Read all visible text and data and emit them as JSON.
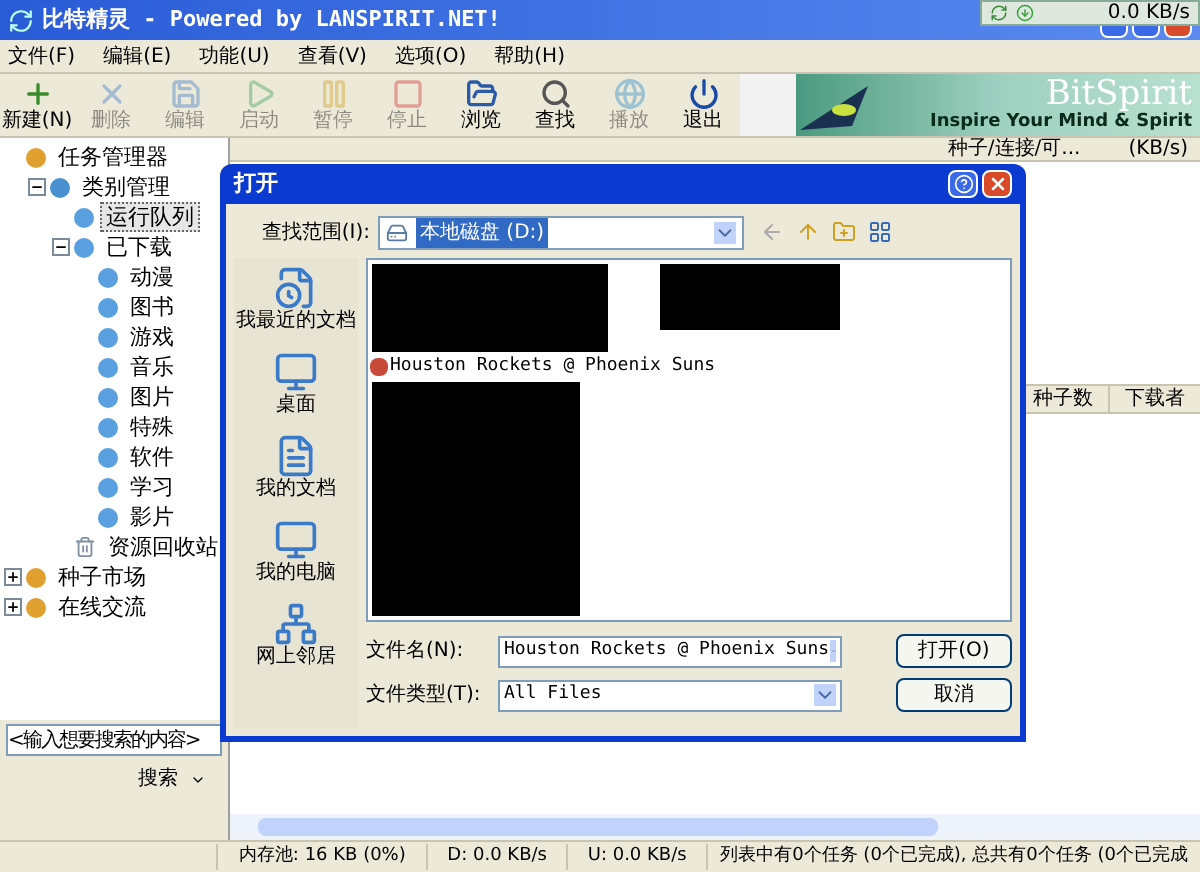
{
  "window": {
    "title": "比特精灵 - Powered by LANSPIRIT.NET!"
  },
  "speed_widget": {
    "reading": "0.0 KB/s"
  },
  "menu": [
    "文件(F)",
    "编辑(E)",
    "功能(U)",
    "查看(V)",
    "选项(O)",
    "帮助(H)"
  ],
  "toolbar": [
    {
      "label": "新建(N)",
      "disabled": false
    },
    {
      "label": "删除",
      "disabled": true
    },
    {
      "label": "编辑",
      "disabled": true
    },
    {
      "label": "启动",
      "disabled": true
    },
    {
      "label": "暂停",
      "disabled": true
    },
    {
      "label": "停止",
      "disabled": true
    },
    {
      "label": "浏览",
      "disabled": false
    },
    {
      "label": "查找",
      "disabled": false
    },
    {
      "label": "播放",
      "disabled": true
    },
    {
      "label": "退出",
      "disabled": false
    }
  ],
  "banner": {
    "title": "BitSpirit",
    "slogan": "Inspire Your Mind & Spirit"
  },
  "tree": [
    {
      "label": "任务管理器",
      "selected": false,
      "children": [
        {
          "label": "类别管理",
          "expanded": true,
          "selected": false,
          "children": [
            {
              "label": "运行队列",
              "selected": true
            },
            {
              "label": "已下载",
              "expanded": true,
              "selected": false,
              "children": [
                {
                  "label": "动漫",
                  "selected": false
                },
                {
                  "label": "图书",
                  "selected": false
                },
                {
                  "label": "游戏",
                  "selected": false
                },
                {
                  "label": "音乐",
                  "selected": false
                },
                {
                  "label": "图片",
                  "selected": false
                },
                {
                  "label": "特殊",
                  "selected": false
                },
                {
                  "label": "软件",
                  "selected": false
                },
                {
                  "label": "学习",
                  "selected": false
                },
                {
                  "label": "影片",
                  "selected": false
                }
              ]
            },
            {
              "label": "资源回收站",
              "selected": false
            }
          ]
        }
      ]
    },
    {
      "label": "种子市场",
      "expanded": false,
      "selected": false
    },
    {
      "label": "在线交流",
      "expanded": false,
      "selected": false
    }
  ],
  "search": {
    "placeholder": "<输入想要搜索的内容>",
    "button": "搜索"
  },
  "task_list": {
    "columns": [
      "种子/连接/可...",
      "(KB/s)"
    ]
  },
  "peer_list": {
    "columns": [
      "种子数",
      "下载者"
    ]
  },
  "status_bar": [
    "内存池: 16 KB (0%)",
    "D: 0.0 KB/s",
    "U: 0.0 KB/s",
    "列表中有0个任务 (0个已完成), 总共有0个任务 (0个已完成"
  ],
  "dialog": {
    "title": "打开",
    "look_in_label": "查找范围(I):",
    "look_in_value": "本地磁盘 (D:)",
    "places": [
      "我最近的文档",
      "桌面",
      "我的文档",
      "我的电脑",
      "网上邻居"
    ],
    "files": [
      {
        "name": "Houston Rockets @ Phoenix Suns"
      }
    ],
    "file_name_label": "文件名(N):",
    "file_name_value": "Houston Rockets @ Phoenix Suns",
    "file_type_label": "文件类型(T):",
    "file_type_value": "All Files",
    "open_button": "打开(O)",
    "cancel_button": "取消"
  }
}
